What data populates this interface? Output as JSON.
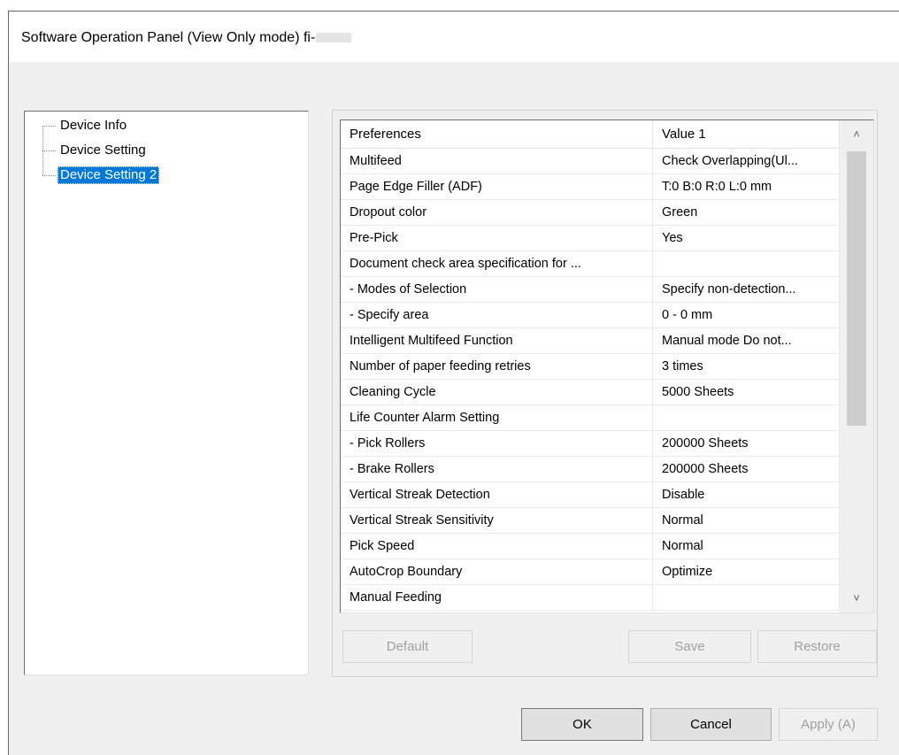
{
  "window": {
    "title": "Software Operation Panel (View Only mode) fi-"
  },
  "tree": {
    "items": [
      {
        "label": "Device Info",
        "selected": false
      },
      {
        "label": "Device Setting",
        "selected": false
      },
      {
        "label": "Device Setting 2",
        "selected": true
      }
    ]
  },
  "list": {
    "columns": [
      "Preferences",
      "Value 1"
    ],
    "rows": [
      [
        "Multifeed",
        "Check Overlapping(Ul..."
      ],
      [
        "Page Edge Filler (ADF)",
        "T:0  B:0  R:0  L:0 mm"
      ],
      [
        "Dropout color",
        "Green"
      ],
      [
        "Pre-Pick",
        "Yes"
      ],
      [
        "Document check area specification for ...",
        ""
      ],
      [
        " - Modes of Selection",
        "Specify non-detection..."
      ],
      [
        " - Specify area",
        "0 - 0 mm"
      ],
      [
        "Intelligent Multifeed Function",
        "Manual mode  Do not..."
      ],
      [
        "Number of paper feeding retries",
        "3 times"
      ],
      [
        "Cleaning Cycle",
        "5000 Sheets"
      ],
      [
        "Life Counter Alarm Setting",
        ""
      ],
      [
        " - Pick Rollers",
        "200000 Sheets"
      ],
      [
        " - Brake Rollers",
        "200000 Sheets"
      ],
      [
        "Vertical Streak Detection",
        "Disable"
      ],
      [
        "Vertical Streak Sensitivity",
        "Normal"
      ],
      [
        "Pick Speed",
        "Normal"
      ],
      [
        "AutoCrop Boundary",
        "Optimize"
      ],
      [
        "Manual Feeding",
        ""
      ]
    ]
  },
  "icons": {
    "scroll_up": "chevron-up-icon",
    "scroll_down": "chevron-down-icon"
  },
  "buttons": {
    "default_label": "Default",
    "save_label": "Save",
    "restore_label": "Restore",
    "ok_label": "OK",
    "cancel_label": "Cancel",
    "apply_label": "Apply (A)"
  },
  "colors": {
    "selection": "#0078d7",
    "window_bg": "#f0f0f0"
  }
}
